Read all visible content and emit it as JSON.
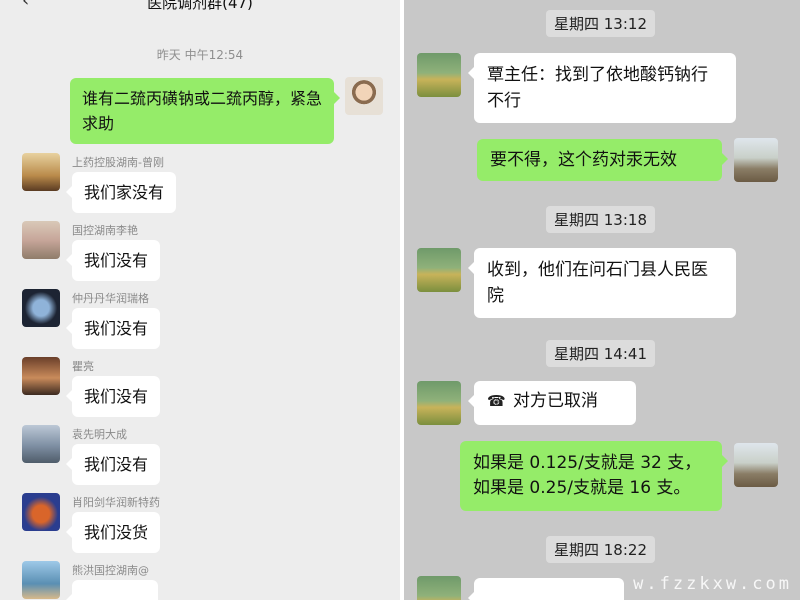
{
  "left": {
    "title": "医院调剂群(47)",
    "time": "昨天 中午12:54",
    "request": "谁有二巯丙磺钠或二巯丙醇，紧急求助",
    "replies": [
      {
        "name": "上药控股湖南-曾刚",
        "text": "我们家没有"
      },
      {
        "name": "国控湖南李艳",
        "text": "我们没有"
      },
      {
        "name": "仲丹丹华润瑞格",
        "text": "我们没有"
      },
      {
        "name": "瞿亮",
        "text": "我们没有"
      },
      {
        "name": "袁先明大成",
        "text": "我们没有"
      },
      {
        "name": "肖阳剑华润新特药",
        "text": "我们没货"
      },
      {
        "name": "熊洪国控湖南@",
        "text": ""
      }
    ]
  },
  "right": {
    "t1": "星期四 13:12",
    "m1": "覃主任：找到了依地酸钙钠行不行",
    "m2": "要不得，这个药对汞无效",
    "t2": "星期四 13:18",
    "m3": "收到，他们在问石门县人民医院",
    "t3": "星期四 14:41",
    "call": "对方已取消",
    "m4a": "如果是 0.125/支就是 32 支，",
    "m4b": "如果是 0.25/支就是 16 支。",
    "t4": "星期四 18:22"
  },
  "watermark": "w.fzzkxw.com",
  "colors": {
    "sent_bubble": "#95ec69",
    "received_bubble": "#ffffff"
  }
}
